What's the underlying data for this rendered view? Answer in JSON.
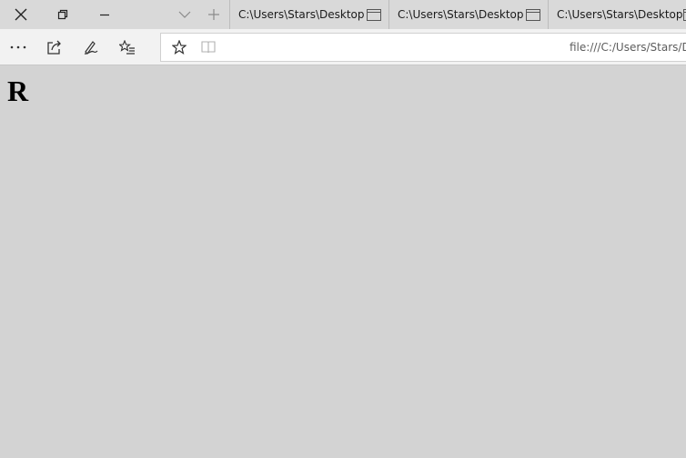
{
  "tabs": [
    {
      "title": "C:\\Users\\Stars\\Desktop"
    },
    {
      "title": "C:\\Users\\Stars\\Desktop"
    },
    {
      "title": "C:\\Users\\Stars\\Desktop"
    }
  ],
  "titlebar": {
    "icons": [
      "close-icon",
      "restore-icon",
      "minimize-icon",
      "chevron-down-icon",
      "plus-icon"
    ]
  },
  "toolbar": {
    "icons": [
      "more-icon",
      "share-icon",
      "pen-icon",
      "favorites-list-icon"
    ]
  },
  "address": {
    "url": "file:///C:/Users/Stars/D",
    "icons": [
      "star-icon",
      "reading-view-icon"
    ]
  },
  "page": {
    "heading": "R"
  },
  "colors": {
    "tabbar_bg": "#d9d9d9",
    "toolbar_bg": "#f2f2f2",
    "content_bg": "#d3d3d3",
    "icon": "#333333"
  }
}
